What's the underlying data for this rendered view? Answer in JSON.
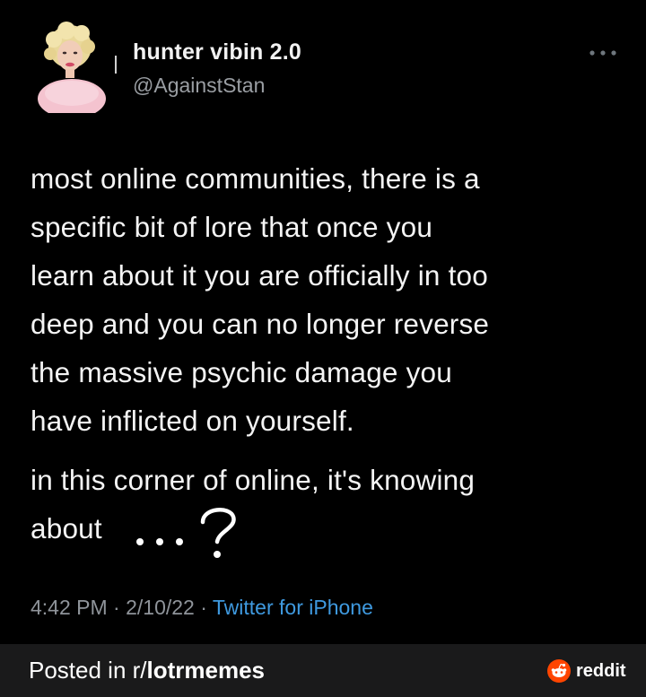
{
  "tweet": {
    "display_name": "hunter vibin 2.0",
    "handle": "@AgainstStan",
    "body_lines": [
      "most online communities, there is a",
      "specific bit of lore that once you",
      "learn about it you are officially in too",
      "deep and you can no longer reverse",
      "the massive psychic damage you",
      "have inflicted on yourself."
    ],
    "para2_line1": "in this corner of online, it's knowing",
    "para2_line2": "about",
    "time": "4:42 PM",
    "date": "2/10/22",
    "source": "Twitter for iPhone",
    "separator": " · "
  },
  "footer": {
    "prefix": "Posted in r/",
    "subreddit": "lotrmemes",
    "brand": "reddit"
  },
  "icons": {
    "more": "more-horizontal-icon",
    "reddit": "reddit-logo-icon",
    "avatar": "avatar"
  },
  "colors": {
    "background": "#000000",
    "footer_bg": "#1a1a1b",
    "link": "#3f9ae0",
    "muted": "#8f949a",
    "reddit_orange": "#ff4500"
  }
}
